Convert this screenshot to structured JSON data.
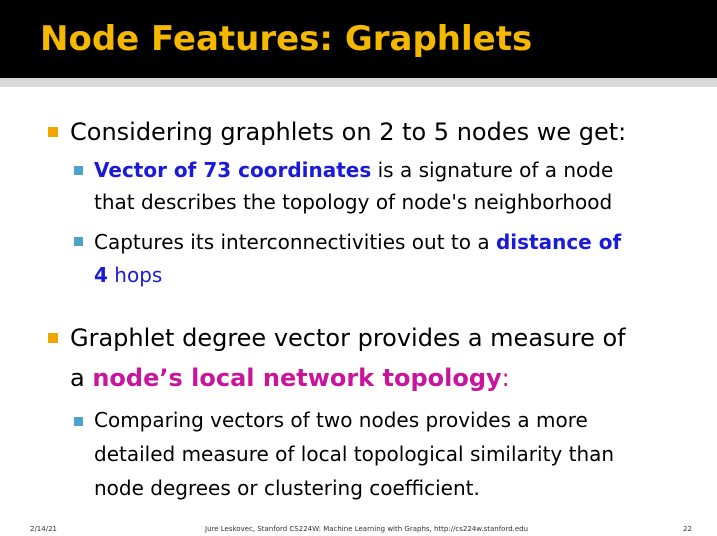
{
  "title": "Node Features: Graphlets",
  "bullets": [
    {
      "text": "Considering graphlets on 2 to 5 nodes we get:",
      "sub": [
        {
          "highlight": "Vector of 73 coordinates",
          "rest_line1": " is a signature of a node",
          "line2": "that describes the topology of node's neighborhood"
        },
        {
          "line1_pre": "Captures its interconnectivities out to a ",
          "highlight_a": "distance of",
          "highlight_b": "4",
          "line2_post": " hops"
        }
      ]
    },
    {
      "line1": "Graphlet degree vector provides a measure of",
      "line2_pre": "a ",
      "highlight": "node’s local network topology",
      "line2_post": ":",
      "sub": [
        {
          "line1": "Comparing vectors of two nodes provides a more",
          "line2": "detailed measure of local topological similarity than",
          "line3": "node degrees or clustering coefficient."
        }
      ]
    }
  ],
  "footer": {
    "date": "2/14/21",
    "credit": "Jure Leskovec, Stanford CS224W: Machine Learning with Graphs, http://cs224w.stanford.edu",
    "page": "22"
  },
  "colors": {
    "title": "#f5b800",
    "bullet_l1": "#f0a500",
    "bullet_l2": "#4ba3c7",
    "highlight_blue": "#1a1adb",
    "highlight_magenta": "#c8159b"
  }
}
